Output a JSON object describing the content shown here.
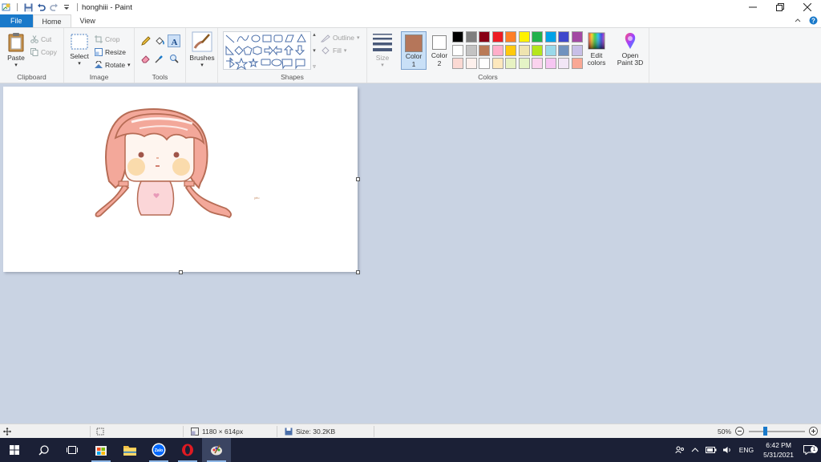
{
  "window": {
    "title": "honghiii - Paint",
    "controls": [
      "minimize-icon",
      "restore-icon",
      "close-icon"
    ]
  },
  "tabs": {
    "file": "File",
    "home": "Home",
    "view": "View"
  },
  "ribbon": {
    "clipboard": {
      "label": "Clipboard",
      "paste": "Paste",
      "cut": "Cut",
      "copy": "Copy"
    },
    "image": {
      "label": "Image",
      "select": "Select",
      "crop": "Crop",
      "resize": "Resize",
      "rotate": "Rotate"
    },
    "tools": {
      "label": "Tools"
    },
    "brushes": {
      "label": "Brushes"
    },
    "shapes": {
      "label": "Shapes",
      "outline": "Outline",
      "fill": "Fill"
    },
    "size": {
      "label": "Size"
    },
    "color1": {
      "label": "Color",
      "num": "1",
      "value": "#b5765a"
    },
    "color2": {
      "label": "Color",
      "num": "2",
      "value": "#ffffff"
    },
    "colors": {
      "label": "Colors",
      "palette_row1": [
        "#000000",
        "#7f7f7f",
        "#880015",
        "#ed1c24",
        "#ff7f27",
        "#fff200",
        "#22b14c",
        "#00a2e8",
        "#3f48cc",
        "#a349a4"
      ],
      "palette_row2": [
        "#ffffff",
        "#c3c3c3",
        "#b97a57",
        "#ffaec9",
        "#ffc90e",
        "#efe4b0",
        "#b5e61d",
        "#99d9ea",
        "#7092be",
        "#c8bfe7"
      ],
      "palette_row3": [
        "#fbd9d3",
        "#fdf0ec",
        "#fefefe",
        "#fde8bd",
        "#e7f2c2",
        "#e4f3c6",
        "#fbd3ee",
        "#f6c6f2",
        "#f2e6f6",
        "#f9a895"
      ],
      "edit": "Edit colors",
      "open3d": "Open Paint 3D"
    }
  },
  "canvas": {
    "tiny_text": "yêu"
  },
  "statusbar": {
    "dimensions": "1180 × 614px",
    "size": "Size: 30.2KB",
    "zoom": "50%",
    "zoom_fraction": 0.5
  },
  "taskbar": {
    "language": "ENG",
    "time": "6:42 PM",
    "date": "5/31/2021",
    "notification_count": "1",
    "zalo_label": "Zalo"
  }
}
